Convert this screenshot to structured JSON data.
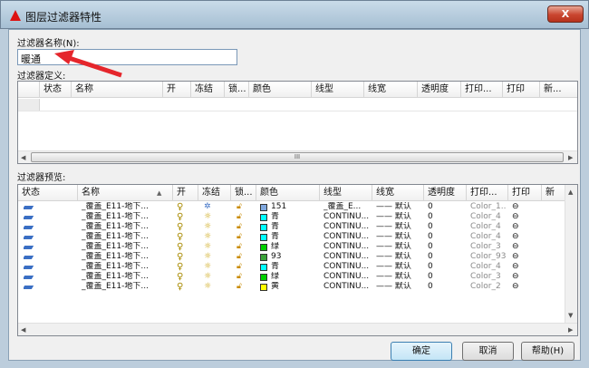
{
  "window": {
    "title": "图层过滤器特性",
    "close_glyph": "X"
  },
  "filter_name": {
    "label": "过滤器名称(N):",
    "value": "暖通"
  },
  "definition": {
    "label": "过滤器定义:",
    "columns": [
      "状态",
      "名称",
      "开",
      "冻结",
      "锁...",
      "颜色",
      "线型",
      "线宽",
      "透明度",
      "打印...",
      "打印",
      "新..."
    ],
    "scroll_grip": "III"
  },
  "preview": {
    "label": "过滤器预览:",
    "columns": [
      "状态",
      "名称",
      "开",
      "冻结",
      "锁...",
      "颜色",
      "线型",
      "线宽",
      "透明度",
      "打印...",
      "打印",
      "新"
    ],
    "rows": [
      {
        "name": "_覆盖_E11-地下...",
        "on": "bulb-on",
        "freeze": "snowflake",
        "color_label": "151",
        "color_hex": "#7fa8df",
        "linetype": "_覆盖_E...",
        "lineweight": "—— 默认",
        "transparency": "0",
        "plot_style": "Color_1..."
      },
      {
        "name": "_覆盖_E11-地下...",
        "on": "bulb",
        "freeze": "sun",
        "color_label": "青",
        "color_hex": "#00ffff",
        "linetype": "CONTINU...",
        "lineweight": "—— 默认",
        "transparency": "0",
        "plot_style": "Color_4"
      },
      {
        "name": "_覆盖_E11-地下...",
        "on": "bulb",
        "freeze": "sun",
        "color_label": "青",
        "color_hex": "#00ffff",
        "linetype": "CONTINU...",
        "lineweight": "—— 默认",
        "transparency": "0",
        "plot_style": "Color_4"
      },
      {
        "name": "_覆盖_E11-地下...",
        "on": "bulb",
        "freeze": "sun",
        "color_label": "青",
        "color_hex": "#00ffff",
        "linetype": "CONTINU...",
        "lineweight": "—— 默认",
        "transparency": "0",
        "plot_style": "Color_4"
      },
      {
        "name": "_覆盖_E11-地下...",
        "on": "bulb",
        "freeze": "sun",
        "color_label": "绿",
        "color_hex": "#00d000",
        "linetype": "CONTINU...",
        "lineweight": "—— 默认",
        "transparency": "0",
        "plot_style": "Color_3"
      },
      {
        "name": "_覆盖_E11-地下...",
        "on": "bulb",
        "freeze": "sun",
        "color_label": "93",
        "color_hex": "#3aa33a",
        "linetype": "CONTINU...",
        "lineweight": "—— 默认",
        "transparency": "0",
        "plot_style": "Color_93"
      },
      {
        "name": "_覆盖_E11-地下...",
        "on": "bulb",
        "freeze": "sun",
        "color_label": "青",
        "color_hex": "#00ffff",
        "linetype": "CONTINU...",
        "lineweight": "—— 默认",
        "transparency": "0",
        "plot_style": "Color_4"
      },
      {
        "name": "_覆盖_E11-地下...",
        "on": "bulb",
        "freeze": "sun",
        "color_label": "绿",
        "color_hex": "#00d000",
        "linetype": "CONTINU...",
        "lineweight": "—— 默认",
        "transparency": "0",
        "plot_style": "Color_3"
      },
      {
        "name": "_覆盖_E11-地下...",
        "on": "bulb",
        "freeze": "sun",
        "color_label": "黄",
        "color_hex": "#ffff00",
        "linetype": "CONTINU...",
        "lineweight": "—— 默认",
        "transparency": "0",
        "plot_style": "Color_2"
      }
    ]
  },
  "buttons": {
    "ok": "确定",
    "cancel": "取消",
    "help": "帮助(H)"
  },
  "colors": {
    "arrow": "#e5262c",
    "layer_icon": "#3b6fc4",
    "title_bar": "#b7cde0"
  },
  "icons": {
    "app": "autocad-logo-icon",
    "layer": "layer-state-icon",
    "print": "printer-icon",
    "lock": "unlock-icon",
    "on": "lightbulb-icon",
    "freeze": "sun-icon"
  }
}
